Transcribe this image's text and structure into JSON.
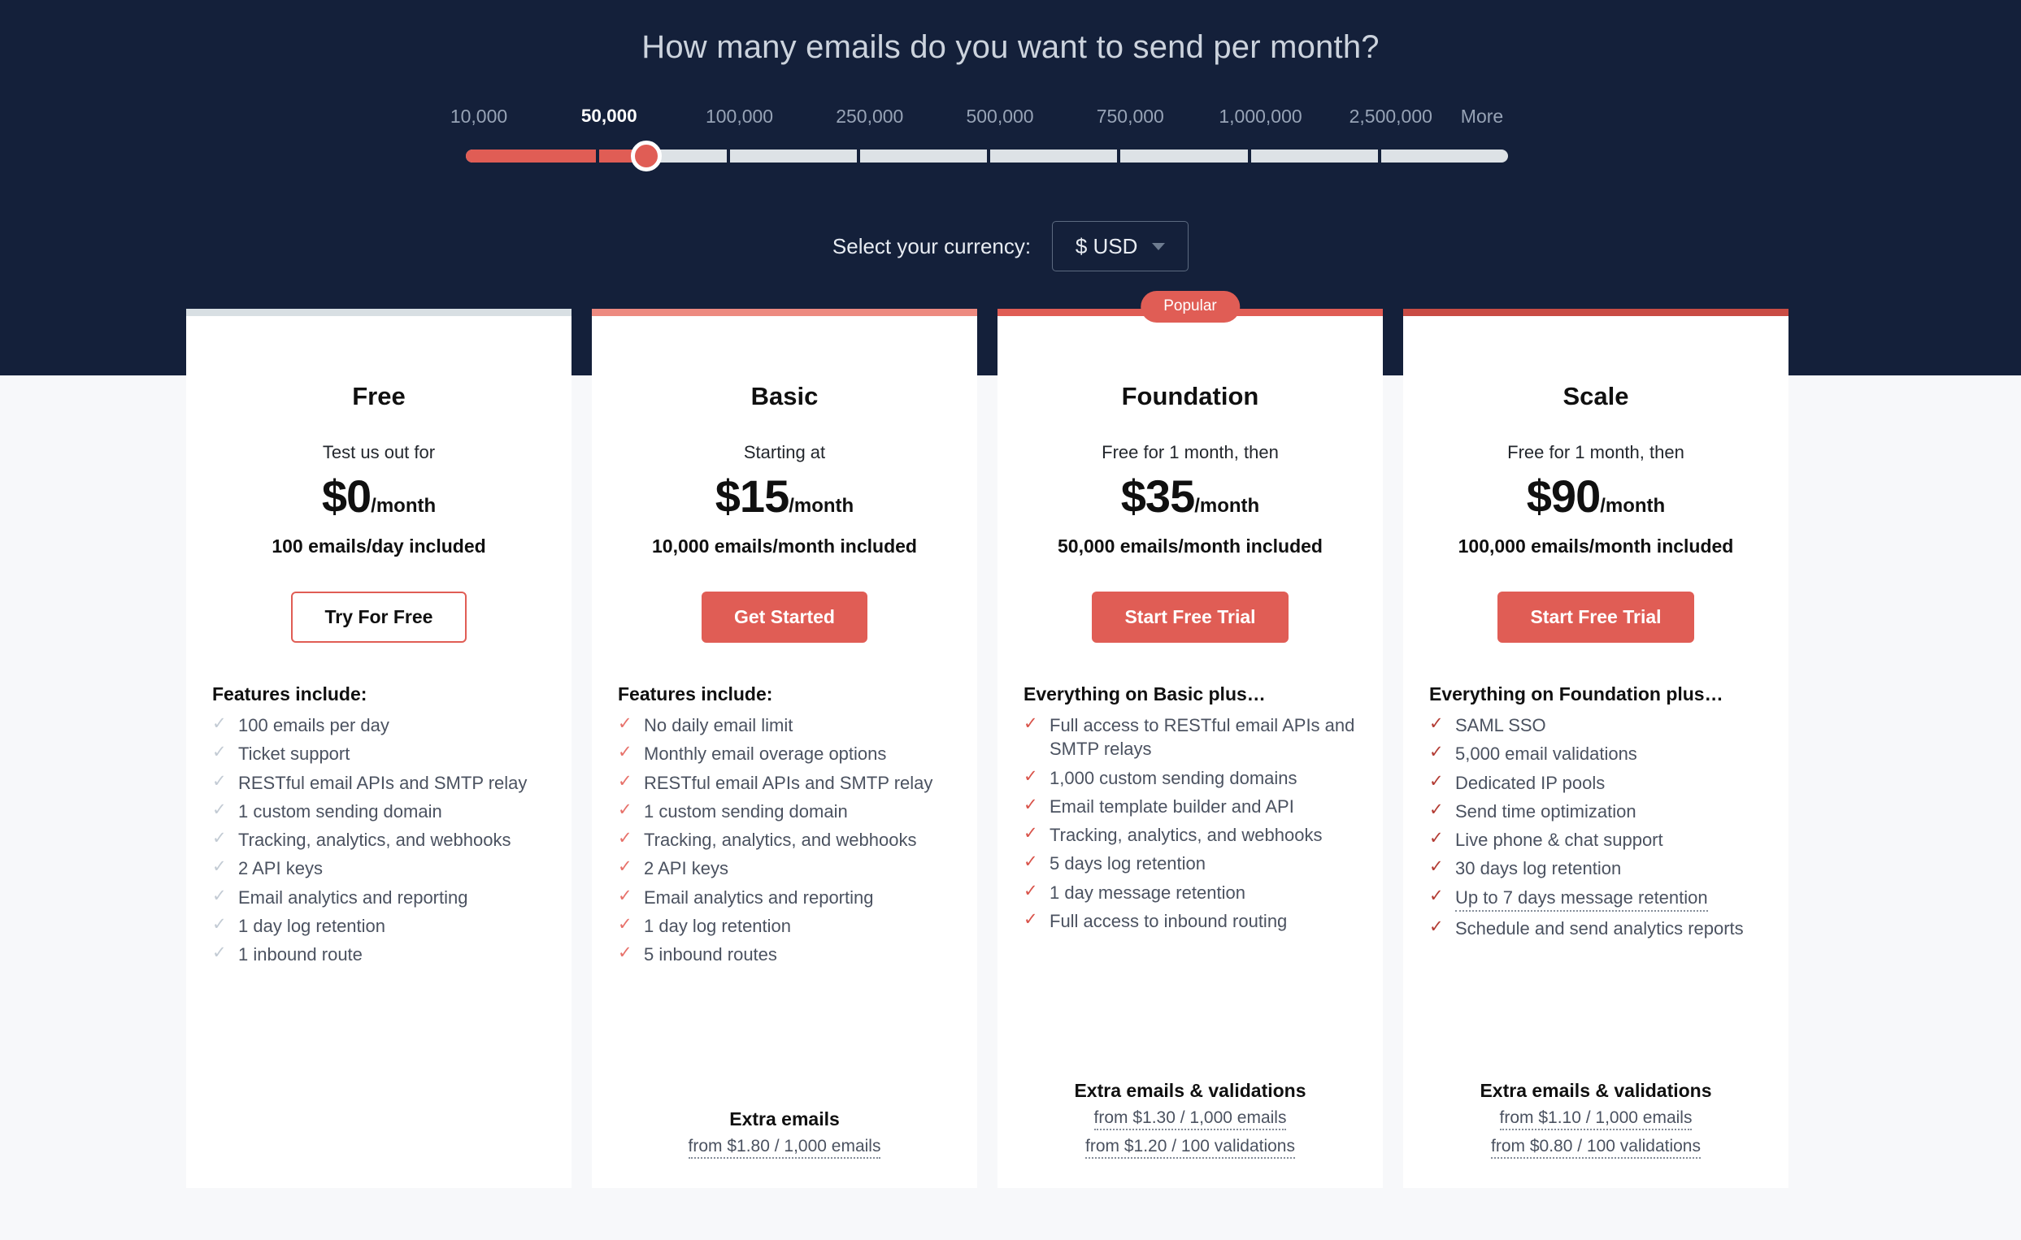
{
  "hero": {
    "title": "How many emails do you want to send per month?"
  },
  "slider": {
    "name": "emails-per-month-slider",
    "selected_value": "50,000",
    "selected_index": 1,
    "labels": [
      "10,000",
      "50,000",
      "100,000",
      "250,000",
      "500,000",
      "750,000",
      "1,000,000",
      "2,500,000",
      "More"
    ],
    "fill_color": "#e05d55",
    "track_color": "#dde2e6"
  },
  "currency": {
    "label": "Select your currency:",
    "selected": "$ USD",
    "caret_icon": "chevron-down-icon"
  },
  "plans": [
    {
      "id": "free",
      "name": "Free",
      "badge": null,
      "tagline": "Test us out for",
      "price": "$0",
      "period": "/month",
      "included": "100 emails/day included",
      "cta": "Try For Free",
      "cta_style": "outline",
      "features_head": "Features include:",
      "check_icon": "check-icon",
      "features": [
        {
          "text": "100 emails per day",
          "tooltip": false
        },
        {
          "text": "Ticket support",
          "tooltip": false
        },
        {
          "text": "RESTful email APIs and SMTP relay",
          "tooltip": false
        },
        {
          "text": "1 custom sending domain",
          "tooltip": false
        },
        {
          "text": "Tracking, analytics, and webhooks",
          "tooltip": false
        },
        {
          "text": "2 API keys",
          "tooltip": false
        },
        {
          "text": "Email analytics and reporting",
          "tooltip": false
        },
        {
          "text": "1 day log retention",
          "tooltip": false
        },
        {
          "text": "1 inbound route",
          "tooltip": false
        }
      ],
      "extras_title": null,
      "extras_lines": []
    },
    {
      "id": "basic",
      "name": "Basic",
      "badge": null,
      "tagline": "Starting at",
      "price": "$15",
      "period": "/month",
      "included": "10,000 emails/month included",
      "cta": "Get Started",
      "cta_style": "solid",
      "features_head": "Features include:",
      "check_icon": "check-icon",
      "features": [
        {
          "text": "No daily email limit",
          "tooltip": false
        },
        {
          "text": "Monthly email overage options",
          "tooltip": false
        },
        {
          "text": "RESTful email APIs and SMTP relay",
          "tooltip": false
        },
        {
          "text": "1 custom sending domain",
          "tooltip": false
        },
        {
          "text": "Tracking, analytics, and webhooks",
          "tooltip": false
        },
        {
          "text": "2 API keys",
          "tooltip": false
        },
        {
          "text": "Email analytics and reporting",
          "tooltip": false
        },
        {
          "text": "1 day log retention",
          "tooltip": false
        },
        {
          "text": "5 inbound routes",
          "tooltip": false
        }
      ],
      "extras_title": "Extra emails",
      "extras_lines": [
        "from $1.80 / 1,000 emails"
      ]
    },
    {
      "id": "foundation",
      "name": "Foundation",
      "badge": "Popular",
      "tagline": "Free for 1 month, then",
      "price": "$35",
      "period": "/month",
      "included": "50,000 emails/month included",
      "cta": "Start Free Trial",
      "cta_style": "solid",
      "features_head": "Everything on Basic plus…",
      "check_icon": "check-icon",
      "features": [
        {
          "text": "Full access to RESTful email APIs and SMTP relays",
          "tooltip": false
        },
        {
          "text": "1,000 custom sending domains",
          "tooltip": false
        },
        {
          "text": "Email template builder and API",
          "tooltip": false
        },
        {
          "text": "Tracking, analytics, and webhooks",
          "tooltip": false
        },
        {
          "text": "5 days log retention",
          "tooltip": false
        },
        {
          "text": "1 day message retention",
          "tooltip": false
        },
        {
          "text": "Full access to inbound routing",
          "tooltip": false
        }
      ],
      "extras_title": "Extra emails & validations",
      "extras_lines": [
        "from $1.30 / 1,000 emails",
        "from $1.20 / 100 validations"
      ]
    },
    {
      "id": "scale",
      "name": "Scale",
      "badge": null,
      "tagline": "Free for 1 month, then",
      "price": "$90",
      "period": "/month",
      "included": "100,000 emails/month included",
      "cta": "Start Free Trial",
      "cta_style": "solid",
      "features_head": "Everything on Foundation plus…",
      "check_icon": "check-icon",
      "features": [
        {
          "text": "SAML SSO",
          "tooltip": false
        },
        {
          "text": "5,000 email validations",
          "tooltip": false
        },
        {
          "text": "Dedicated IP pools",
          "tooltip": false
        },
        {
          "text": "Send time optimization",
          "tooltip": false
        },
        {
          "text": "Live phone & chat support",
          "tooltip": false
        },
        {
          "text": "30 days log retention",
          "tooltip": false
        },
        {
          "text": "Up to 7 days message retention",
          "tooltip": true
        },
        {
          "text": "Schedule and send analytics reports",
          "tooltip": false
        }
      ],
      "extras_title": "Extra emails & validations",
      "extras_lines": [
        "from $1.10 / 1,000 emails",
        "from $0.80 / 100 validations"
      ]
    }
  ],
  "colors": {
    "hero_bg": "#14203a",
    "body_bg": "#f7f8fa",
    "accent": "#e05d55",
    "card_bg": "#ffffff"
  }
}
